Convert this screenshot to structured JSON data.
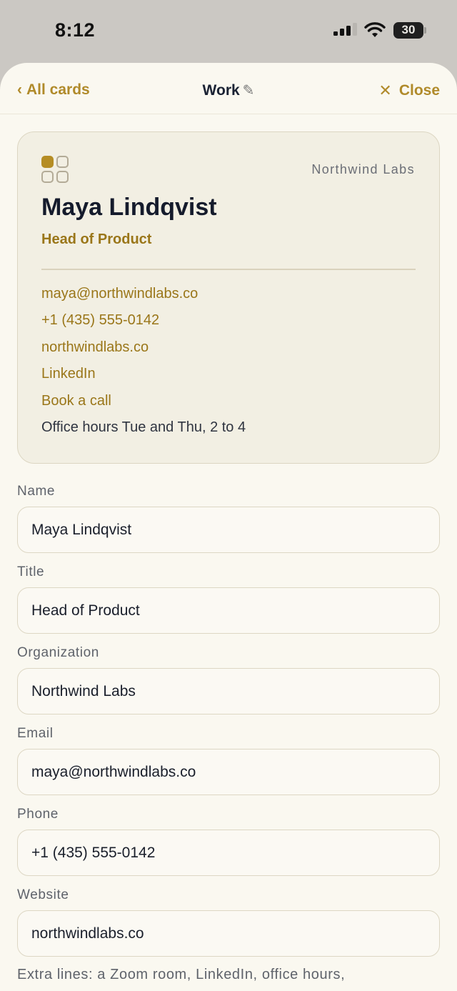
{
  "status": {
    "time": "8:12",
    "battery": "30"
  },
  "nav": {
    "back_label": "All cards",
    "title": "Work",
    "close_label": "Close"
  },
  "card": {
    "organization": "Northwind Labs",
    "name": "Maya Lindqvist",
    "title": "Head of Product",
    "lines": [
      {
        "text": "maya@northwindlabs.co",
        "link": true
      },
      {
        "text": "+1 (435) 555-0142",
        "link": true
      },
      {
        "text": "northwindlabs.co",
        "link": true
      },
      {
        "text": "LinkedIn",
        "link": true
      },
      {
        "text": "Book a call",
        "link": true
      },
      {
        "text": "Office hours Tue and Thu, 2 to 4",
        "link": false
      }
    ]
  },
  "form": {
    "fields": [
      {
        "label": "Name",
        "value": "Maya Lindqvist"
      },
      {
        "label": "Title",
        "value": "Head of Product"
      },
      {
        "label": "Organization",
        "value": "Northwind Labs"
      },
      {
        "label": "Email",
        "value": "maya@northwindlabs.co"
      },
      {
        "label": "Phone",
        "value": "+1 (435) 555-0142"
      },
      {
        "label": "Website",
        "value": "northwindlabs.co"
      }
    ],
    "extra_hint": "Extra lines: a Zoom room, LinkedIn, office hours,"
  },
  "colors": {
    "accent": "#b08a2a",
    "sheet_bg": "#faf8f0",
    "card_bg": "#f2efe3"
  },
  "icons": [
    "signal-icon",
    "wifi-icon",
    "battery-icon",
    "chevron-left-icon",
    "pencil-icon",
    "close-icon",
    "card-logo-icon"
  ]
}
